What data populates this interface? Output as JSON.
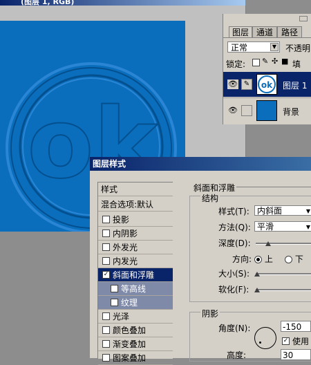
{
  "document": {
    "title": "(图层 1, RGB)",
    "logo_text": "ok"
  },
  "layers_panel": {
    "tabs": [
      "图层",
      "通道",
      "路径"
    ],
    "blend_mode": "正常",
    "opacity_label": "不透明",
    "lock_label": "锁定:",
    "fill_label": "填",
    "layers": [
      {
        "name": "图层 1",
        "selected": true
      },
      {
        "name": "背景",
        "selected": false
      }
    ]
  },
  "layer_style": {
    "title": "图层样式",
    "list_header": "样式",
    "blend_options": "混合选项:默认",
    "items": [
      {
        "label": "投影",
        "checked": false,
        "sub": false,
        "selected": false
      },
      {
        "label": "内阴影",
        "checked": false,
        "sub": false,
        "selected": false
      },
      {
        "label": "外发光",
        "checked": false,
        "sub": false,
        "selected": false
      },
      {
        "label": "内发光",
        "checked": false,
        "sub": false,
        "selected": false
      },
      {
        "label": "斜面和浮雕",
        "checked": true,
        "sub": false,
        "selected": true
      },
      {
        "label": "等高线",
        "checked": false,
        "sub": true,
        "selected": false
      },
      {
        "label": "纹理",
        "checked": false,
        "sub": true,
        "selected": false
      },
      {
        "label": "光泽",
        "checked": false,
        "sub": false,
        "selected": false
      },
      {
        "label": "颜色叠加",
        "checked": false,
        "sub": false,
        "selected": false
      },
      {
        "label": "渐变叠加",
        "checked": false,
        "sub": false,
        "selected": false
      },
      {
        "label": "图案叠加",
        "checked": false,
        "sub": false,
        "selected": false
      }
    ],
    "bevel": {
      "section_title": "斜面和浮雕",
      "structure_title": "结构",
      "style_label": "样式(T):",
      "style_value": "内斜面",
      "method_label": "方法(Q):",
      "method_value": "平滑",
      "depth_label": "深度(D):",
      "direction_label": "方向:",
      "dir_up": "上",
      "dir_down": "下",
      "size_label": "大小(S):",
      "soften_label": "软化(F):",
      "shading_title": "阴影",
      "angle_label": "角度(N):",
      "angle_value": "-150",
      "use_global_label": "使用",
      "altitude_label": "高度:",
      "altitude_value": "30"
    }
  }
}
